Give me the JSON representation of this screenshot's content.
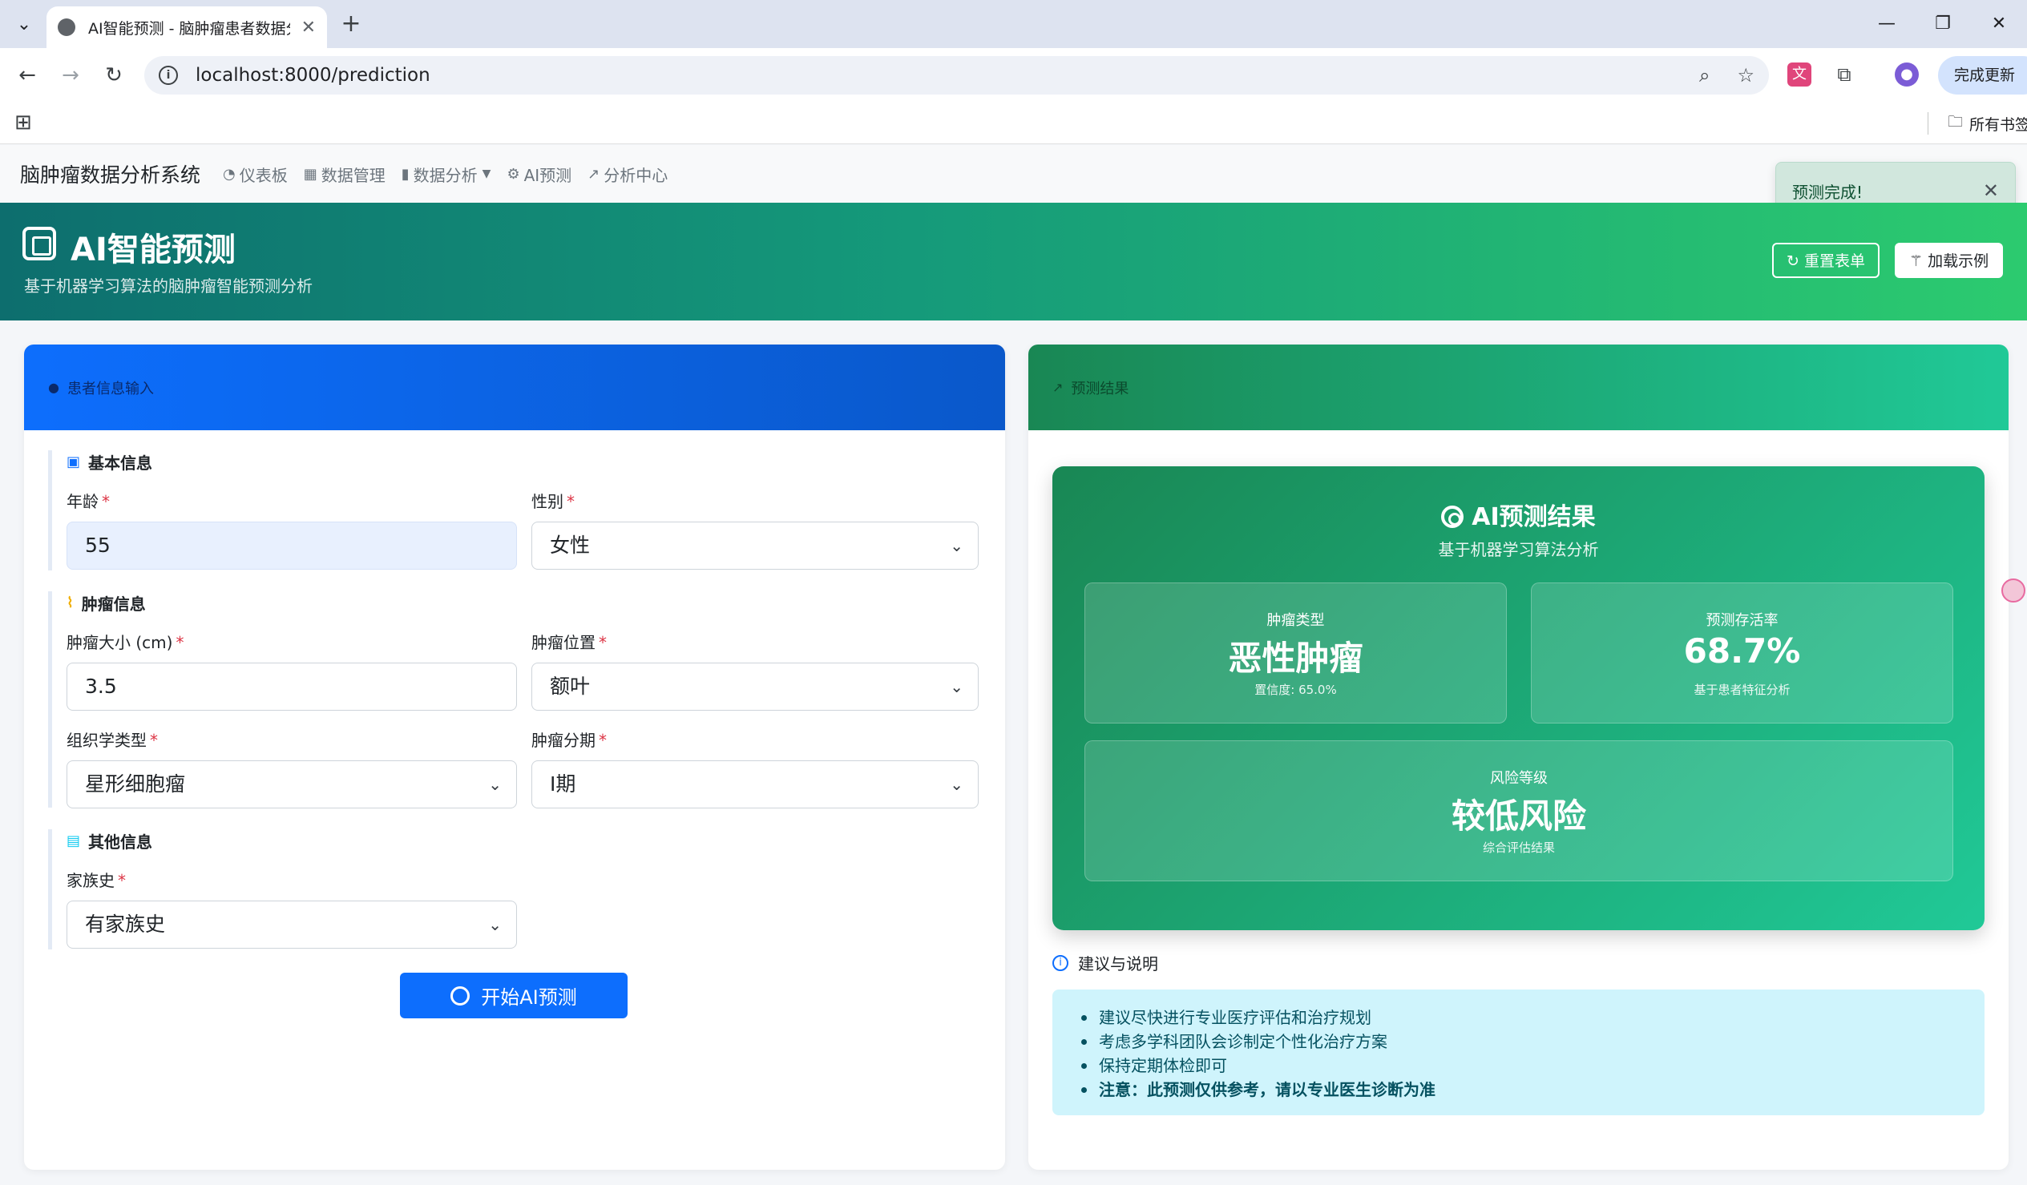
{
  "browser": {
    "tab_title": "AI智能预测 - 脑肿瘤患者数据分",
    "url": "localhost:8000/prediction",
    "update_label": "完成更新",
    "bookmarks_all": "所有书签"
  },
  "nav": {
    "brand": "脑肿瘤数据分析系统",
    "links": [
      "仪表板",
      "数据管理",
      "数据分析",
      "AI预测",
      "分析中心"
    ]
  },
  "toast": {
    "message": "预测完成!"
  },
  "hero": {
    "title": "AI智能预测",
    "subtitle": "基于机器学习算法的脑肿瘤智能预测分析",
    "reset_label": "重置表单",
    "example_label": "加载示例"
  },
  "form": {
    "header": "患者信息输入",
    "sections": {
      "basic": "基本信息",
      "tumor": "肿瘤信息",
      "other": "其他信息"
    },
    "fields": {
      "age": {
        "label": "年龄",
        "value": "55"
      },
      "gender": {
        "label": "性别",
        "value": "女性"
      },
      "tumor_size": {
        "label": "肿瘤大小 (cm)",
        "value": "3.5"
      },
      "tumor_location": {
        "label": "肿瘤位置",
        "value": "额叶"
      },
      "histology": {
        "label": "组织学类型",
        "value": "星形细胞瘤"
      },
      "stage": {
        "label": "肿瘤分期",
        "value": "I期"
      },
      "family_history": {
        "label": "家族史",
        "value": "有家族史"
      }
    },
    "required_mark": "*",
    "submit_label": "开始AI预测"
  },
  "result": {
    "header": "预测结果",
    "title": "AI预测结果",
    "subtitle": "基于机器学习算法分析",
    "tumor_type": {
      "label": "肿瘤类型",
      "value": "恶性肿瘤",
      "note": "置信度: 65.0%"
    },
    "survival": {
      "label": "预测存活率",
      "value": "68.7%",
      "note": "基于患者特征分析"
    },
    "risk": {
      "label": "风险等级",
      "value": "较低风险",
      "note": "综合评估结果"
    }
  },
  "advice": {
    "title": "建议与说明",
    "items": [
      "建议尽快进行专业医疗评估和治疗规划",
      "考虑多学科团队会诊制定个性化治疗方案",
      "保持定期体检即可",
      "注意：此预测仅供参考，请以专业医生诊断为准"
    ]
  },
  "colors": {
    "primary": "#0d6efd",
    "success": "#198754",
    "teal": "#20c997",
    "danger": "#dc3545"
  }
}
